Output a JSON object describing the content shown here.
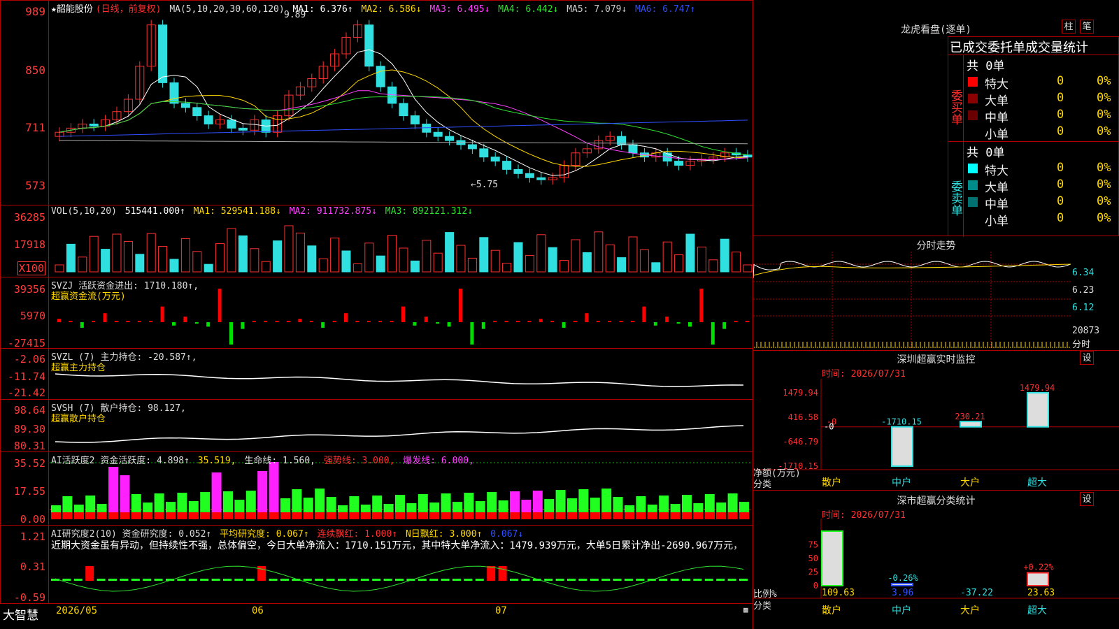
{
  "main": {
    "stock_name": "★韶能股份",
    "period_label": "(日线，前复权)",
    "ma_label": "MA(5,10,20,30,60,120)",
    "ma1": "MA1: 6.376↑",
    "ma2": "MA2: 6.586↓",
    "ma3": "MA3: 6.495↓",
    "ma4": "MA4: 6.442↓",
    "ma5": "MA5: 7.079↓",
    "ma6": "MA6: 6.747↑",
    "y_ticks": [
      "989",
      "850",
      "711",
      "573"
    ],
    "high_mark": "9.89",
    "low_mark": "←5.75"
  },
  "vol": {
    "header": "VOL(5,10,20)",
    "value": "515441.000↑",
    "ma1": "MA1: 529541.188↓",
    "ma2": "MA2: 911732.875↓",
    "ma3": "MA3: 892121.312↓",
    "y_ticks": [
      "36285",
      "17918",
      "X100"
    ]
  },
  "svzj": {
    "header": "SVZJ  活跃资金进出: 1710.180↑,",
    "title": "超赢资金流(万元)",
    "y_ticks": [
      "39356",
      "5970",
      "-27415"
    ]
  },
  "svzl": {
    "header": "SVZL (7) 主力持仓: -20.587↑,",
    "title": "超赢主力持仓",
    "y_ticks": [
      "-2.06",
      "-11.74",
      "-21.42"
    ]
  },
  "svsh": {
    "header": "SVSH (7) 散户持仓: 98.127,",
    "title": "超赢散户持仓",
    "y_ticks": [
      "98.64",
      "89.30",
      "80.31"
    ]
  },
  "ai_active": {
    "h1": "AI活跃度2 资金活跃度: 4.898↑",
    "h2": "35.519,",
    "h3": "生命线: 1.560,",
    "h4": "强势线: 3.000,",
    "h5": "爆发线: 6.000,",
    "y_ticks": [
      "35.52",
      "17.55",
      "0.00"
    ]
  },
  "ai_research": {
    "h1": "AI研究度2(10) 资金研究度: 0.052↑",
    "h2": "平均研究度: 0.067↑",
    "h3": "连续飘红: 1.000↑",
    "h4": "N日飘红: 3.000↑",
    "h5": "0.067↓",
    "comment": "近期大资金虽有异动，但持续性不强，总体偏空，今日大单净流入：1710.151万元，其中特大单净流入：1479.939万元，大单5日累计净出-2690.967万元，",
    "y_ticks": [
      "1.21",
      "0.31",
      "-0.59"
    ]
  },
  "bottom": {
    "brand": "大智慧",
    "date1": "2026/05",
    "date2": "06",
    "date3": "07"
  },
  "dragon": {
    "title": "龙虎看盘(逐单)",
    "btn1": "柱",
    "btn2": "笔",
    "subtitle": "已成交委托单成交量统计",
    "buy_label": "委买单",
    "sell_label": "委卖单",
    "buy_total": "共 0单",
    "sell_total": "共 0单",
    "buy_rows": [
      {
        "label": "特大",
        "n": "0",
        "p": "0%",
        "color": "#ff0000"
      },
      {
        "label": "大单",
        "n": "0",
        "p": "0%",
        "color": "#8b0000"
      },
      {
        "label": "中单",
        "n": "0",
        "p": "0%",
        "color": "#6b0000"
      },
      {
        "label": "小单",
        "n": "0",
        "p": "0%",
        "color": "#000000"
      }
    ],
    "sell_rows": [
      {
        "label": "特大",
        "n": "0",
        "p": "0%",
        "color": "#00ffff"
      },
      {
        "label": "大单",
        "n": "0",
        "p": "0%",
        "color": "#008b8b"
      },
      {
        "label": "中单",
        "n": "0",
        "p": "0%",
        "color": "#007070"
      },
      {
        "label": "小单",
        "n": "0",
        "p": "0%",
        "color": "#000000"
      }
    ]
  },
  "intraday": {
    "title": "分时走势",
    "y_ticks": [
      "6.34",
      "6.23",
      "6.12",
      "20873",
      "分时"
    ]
  },
  "monitor": {
    "title": "深圳超赢实时监控",
    "btn": "设",
    "time": "时间: 2026/07/31",
    "y_ticks": [
      "1479.94",
      "416.58",
      "-0",
      "-646.79",
      "-1710.15"
    ],
    "axis_left": "净额(万元)",
    "axis_left2": "分类",
    "categories": [
      "散户",
      "中户",
      "大户",
      "超大"
    ]
  },
  "classify": {
    "title": "深市超赢分类统计",
    "btn": "设",
    "time": "时间: 2026/07/31",
    "y_ticks": [
      "75",
      "50",
      "25",
      "0"
    ],
    "axis_left": "比例%",
    "axis_left2": "分类",
    "categories": [
      "散户",
      "中户",
      "大户",
      "超大"
    ]
  },
  "chart_data": [
    {
      "type": "bar",
      "title": "深圳超赢实时监控",
      "categories": [
        "散户",
        "中户",
        "大户",
        "超大"
      ],
      "values": [
        0,
        -1710.15,
        230.21,
        1479.94
      ],
      "value_labels": [
        "-0",
        "-1710.15",
        "230.21",
        "1479.94"
      ],
      "ylabel": "净额(万元)",
      "ylim": [
        -1710.15,
        1479.94
      ],
      "y_ticks": [
        1479.94,
        416.58,
        0,
        -646.79,
        -1710.15
      ]
    },
    {
      "type": "bar",
      "title": "深市超赢分类统计",
      "categories": [
        "散户",
        "中户",
        "大户",
        "超大"
      ],
      "values": [
        109.63,
        3.96,
        -37.22,
        23.63
      ],
      "bar_labels": [
        "",
        "-0.26%",
        "",
        "+0.22%"
      ],
      "ylabel": "比例%",
      "ylim": [
        0,
        100
      ],
      "y_ticks": [
        0,
        25,
        50,
        75
      ]
    }
  ]
}
